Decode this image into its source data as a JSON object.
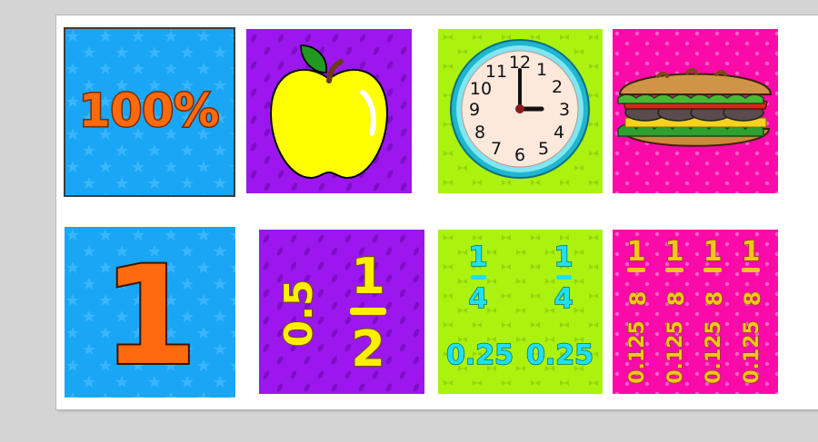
{
  "cards": {
    "percent": {
      "text": "100%"
    },
    "whole": {
      "text": "1"
    },
    "half": {
      "decimal": "0.5",
      "fraction_num": "1",
      "fraction_den": "2"
    },
    "quarter": {
      "fraction_num": "1",
      "fraction_den": "4",
      "decimal": "0.25"
    },
    "eighth": {
      "fraction_num": "1",
      "fraction_den": "8",
      "decimal": "0.125"
    },
    "clock": {
      "numbers": [
        "12",
        "1",
        "2",
        "3",
        "4",
        "5",
        "6",
        "7",
        "8",
        "9",
        "10",
        "11"
      ]
    }
  },
  "colors": {
    "blue_bg": "#19a6f5",
    "purple_bg": "#9b17ee",
    "green_bg": "#abf20f",
    "pink_bg": "#fa0aa8",
    "orange_text": "#ff6a0e",
    "yellow_text": "#ffee00",
    "cyan_text": "#20e0f0",
    "gold_text": "#f5c518"
  },
  "icons": [
    "apple-icon",
    "clock-icon",
    "sandwich-icon",
    "star-pattern",
    "bow-pattern",
    "dot-pattern"
  ]
}
